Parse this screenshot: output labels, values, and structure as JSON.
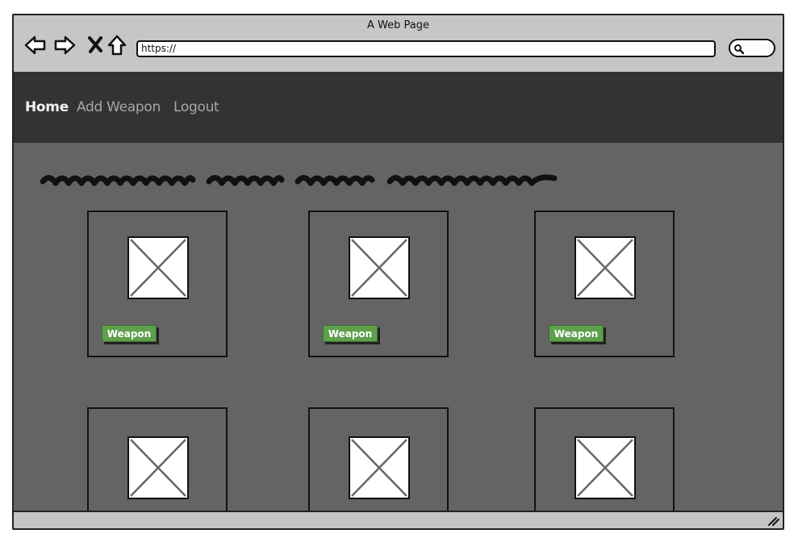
{
  "browser": {
    "title": "A Web Page",
    "url": "https://",
    "icons": [
      "back-arrow-icon",
      "forward-arrow-icon",
      "close-x-icon",
      "home-icon",
      "search-icon"
    ]
  },
  "navbar": {
    "items": [
      {
        "label": "Home",
        "active": true
      },
      {
        "label": "Add Weapon",
        "active": false
      },
      {
        "label": "Logout",
        "active": false
      }
    ]
  },
  "cards": [
    {
      "button_label": "Weapon"
    },
    {
      "button_label": "Weapon"
    },
    {
      "button_label": "Weapon"
    },
    {
      "button_label": ""
    },
    {
      "button_label": ""
    },
    {
      "button_label": ""
    }
  ],
  "colors": {
    "chrome": "#c4c4c4",
    "navbar_bg": "#333333",
    "content_bg": "#646464",
    "button_green": "#5fa04d"
  }
}
